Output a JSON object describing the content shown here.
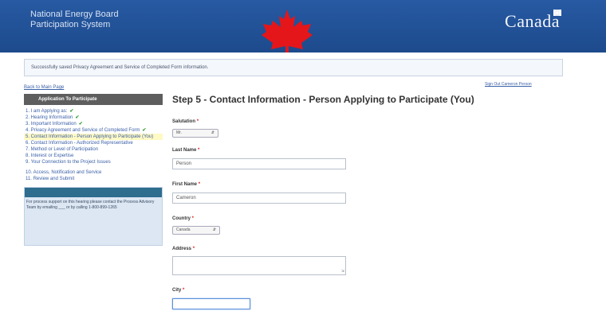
{
  "header": {
    "org_line1": "National Energy Board",
    "org_line2": "Participation System",
    "wordmark": "Canada",
    "colors": {
      "header_bg": "#275aa3",
      "leaf": "#e4161a"
    }
  },
  "banner": {
    "text": "Successfully saved Privacy Agreement and Service of Completed Form information."
  },
  "links": {
    "back_to_main": "Back to Main Page",
    "sign_out": "Sign Out  Cameron Person"
  },
  "sidebar": {
    "header": "Application To Participate",
    "steps": [
      {
        "label": "1. I am Applying as:",
        "done": "✔"
      },
      {
        "label": "2. Hearing Information",
        "done": "✔"
      },
      {
        "label": "3. Important Information",
        "done": "✔"
      },
      {
        "label": "4. Privacy Agreement and Service of Completed Form",
        "done": "✔"
      },
      {
        "label": "5. Contact Information - Person Applying to Participate (You)",
        "done": ""
      },
      {
        "label": "6. Contact Information - Authorized Representative",
        "done": ""
      },
      {
        "label": "7. Method or Level of Participation",
        "done": ""
      },
      {
        "label": "8. Interest or Expertise",
        "done": ""
      },
      {
        "label": "9. Your Connection to the Project Issues",
        "done": ""
      },
      {
        "label": "10. Access, Notification and Service",
        "done": ""
      },
      {
        "label": "11. Review and Submit",
        "done": ""
      }
    ],
    "help_text": "For process support on this hearing please contact the Process Advisory Team by emailing ___ or by calling 1-800-899-1265"
  },
  "form": {
    "title": "Step 5 - Contact Information - Person Applying to Participate (You)",
    "required_marker": "*",
    "salutation": {
      "label": "Salutation",
      "value": "Mr."
    },
    "last_name": {
      "label": "Last Name",
      "value": "Person"
    },
    "first_name": {
      "label": "First Name",
      "value": "Cameron"
    },
    "country": {
      "label": "Country",
      "value": "Canada"
    },
    "address": {
      "label": "Address",
      "value": ""
    },
    "city": {
      "label": "City",
      "value": ""
    }
  }
}
